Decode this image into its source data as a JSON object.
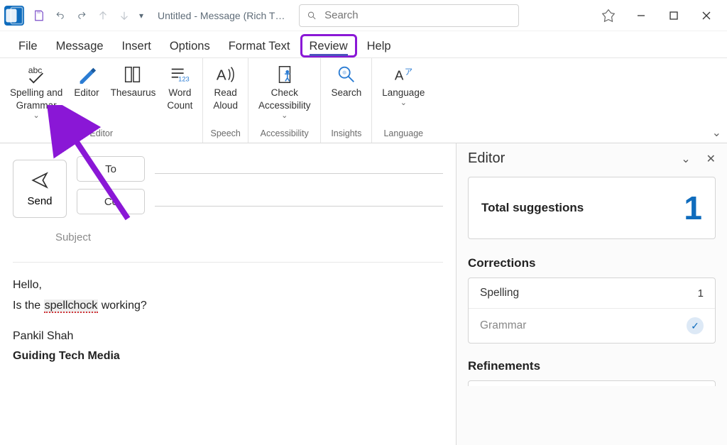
{
  "title": "Untitled  -  Message (Rich T…",
  "search_placeholder": "Search",
  "tabs": {
    "file": "File",
    "message": "Message",
    "insert": "Insert",
    "options": "Options",
    "format": "Format Text",
    "review": "Review",
    "help": "Help"
  },
  "ribbon": {
    "spelling": "Spelling and\nGrammar",
    "editor": "Editor",
    "thesaurus": "Thesaurus",
    "wordcount": "Word\nCount",
    "group_editor": "Editor",
    "readaloud": "Read\nAloud",
    "group_speech": "Speech",
    "checkacc": "Check\nAccessibility",
    "group_acc": "Accessibility",
    "search": "Search",
    "group_insights": "Insights",
    "language": "Language",
    "group_language": "Language"
  },
  "compose": {
    "send": "Send",
    "to": "To",
    "cc": "Cc",
    "subject": "Subject",
    "body_greeting": "Hello,",
    "body_q_pre": "Is the ",
    "body_q_err": "spellchock",
    "body_q_post": " working?",
    "sig_name": "Pankil Shah",
    "sig_org": "Guiding Tech Media"
  },
  "editor_pane": {
    "title": "Editor",
    "total_label": "Total suggestions",
    "total_count": "1",
    "corrections": "Corrections",
    "spelling_label": "Spelling",
    "spelling_count": "1",
    "grammar_label": "Grammar",
    "refinements": "Refinements"
  }
}
